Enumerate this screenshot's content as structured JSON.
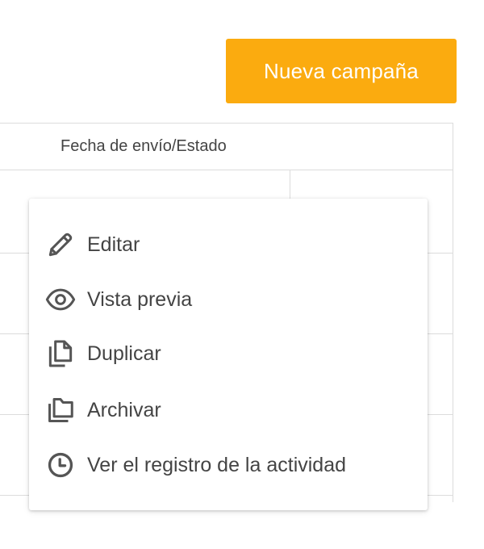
{
  "header": {
    "new_campaign_label": "Nueva campaña"
  },
  "table": {
    "column_header": "Fecha de envío/Estado"
  },
  "context_menu": {
    "items": [
      {
        "label": "Editar",
        "icon": "pencil-icon"
      },
      {
        "label": "Vista previa",
        "icon": "eye-icon"
      },
      {
        "label": "Duplicar",
        "icon": "copy-icon"
      },
      {
        "label": "Archivar",
        "icon": "archive-folder-icon"
      },
      {
        "label": "Ver el registro de la actividad",
        "icon": "clock-icon"
      }
    ]
  },
  "colors": {
    "accent": "#fbab0f",
    "text": "#444444",
    "border": "#dcdcdc"
  }
}
